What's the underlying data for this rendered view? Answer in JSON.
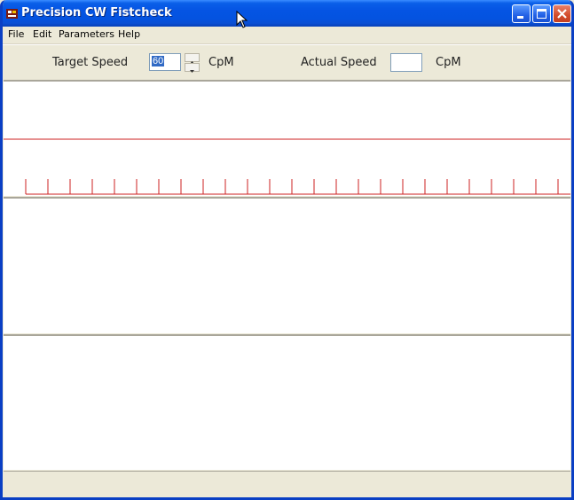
{
  "window": {
    "title": "Precision CW Fistcheck",
    "icon": "morse-key-icon",
    "colors": {
      "titlebar": "#0554e3",
      "frame": "#ece9d8",
      "timing_line": "#cc2222"
    }
  },
  "menubar": {
    "items": [
      {
        "label": "File"
      },
      {
        "label": "Edit"
      },
      {
        "label": "Parameters"
      },
      {
        "label": "Help"
      }
    ]
  },
  "toolbar": {
    "target_speed_label": "Target Speed",
    "target_speed_value": "60",
    "target_unit": "CpM",
    "actual_speed_label": "Actual Speed",
    "actual_speed_value": "",
    "actual_unit": "CpM"
  },
  "timing_panel": {
    "tick_count": 25
  }
}
